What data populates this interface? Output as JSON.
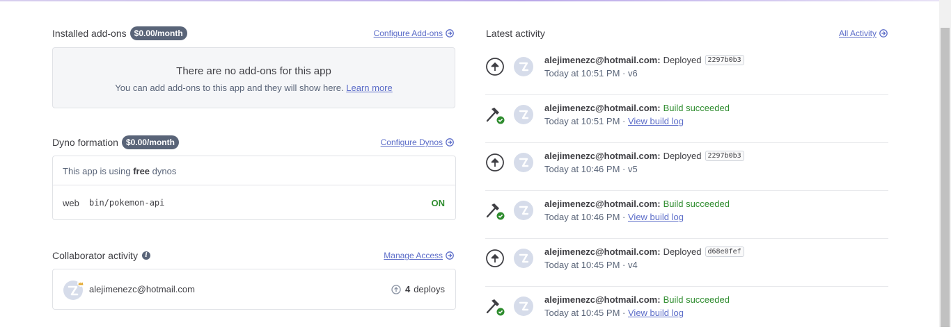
{
  "addons": {
    "title": "Installed add-ons",
    "price": "$0.00/month",
    "configure_link": "Configure Add-ons",
    "empty_title": "There are no add-ons for this app",
    "empty_sub": "You can add add-ons to this app and they will show here.",
    "learn_more": "Learn more"
  },
  "dynos": {
    "title": "Dyno formation",
    "price": "$0.00/month",
    "configure_link": "Configure Dynos",
    "using_prefix": "This app is using",
    "using_tier": "free",
    "using_suffix": "dynos",
    "process_type": "web",
    "command": "bin/pokemon-api",
    "status": "ON"
  },
  "collaborators": {
    "title": "Collaborator activity",
    "manage_link": "Manage Access",
    "email": "alejimenezc@hotmail.com",
    "deploy_count": "4",
    "deploy_label": "deploys"
  },
  "activity": {
    "title": "Latest activity",
    "all_link": "All Activity",
    "items": [
      {
        "kind": "deploy",
        "user": "alejimenezc@hotmail.com:",
        "action": "Deployed",
        "commit": "2297b0b3",
        "time": "Today at 10:51 PM",
        "sep": "·",
        "version": "v6"
      },
      {
        "kind": "build",
        "user": "alejimenezc@hotmail.com:",
        "action": "Build succeeded",
        "time": "Today at 10:51 PM",
        "sep": "·",
        "link": "View build log"
      },
      {
        "kind": "deploy",
        "user": "alejimenezc@hotmail.com:",
        "action": "Deployed",
        "commit": "2297b0b3",
        "time": "Today at 10:46 PM",
        "sep": "·",
        "version": "v5"
      },
      {
        "kind": "build",
        "user": "alejimenezc@hotmail.com:",
        "action": "Build succeeded",
        "time": "Today at 10:46 PM",
        "sep": "·",
        "link": "View build log"
      },
      {
        "kind": "deploy",
        "user": "alejimenezc@hotmail.com:",
        "action": "Deployed",
        "commit": "d68e0fef",
        "time": "Today at 10:45 PM",
        "sep": "·",
        "version": "v4"
      },
      {
        "kind": "build",
        "user": "alejimenezc@hotmail.com:",
        "action": "Build succeeded",
        "time": "Today at 10:45 PM",
        "sep": "·",
        "link": "View build log"
      }
    ]
  },
  "icons": {
    "arrow": "arrow-circle-right-icon",
    "deploy": "deploy-arrow-icon",
    "build": "hammer-check-icon",
    "avatar": "default-avatar-icon",
    "info": "info-icon"
  },
  "colors": {
    "badge": "#596478",
    "link": "#5b6cc8",
    "success": "#2e8c2e",
    "text": "#3f3f44"
  }
}
